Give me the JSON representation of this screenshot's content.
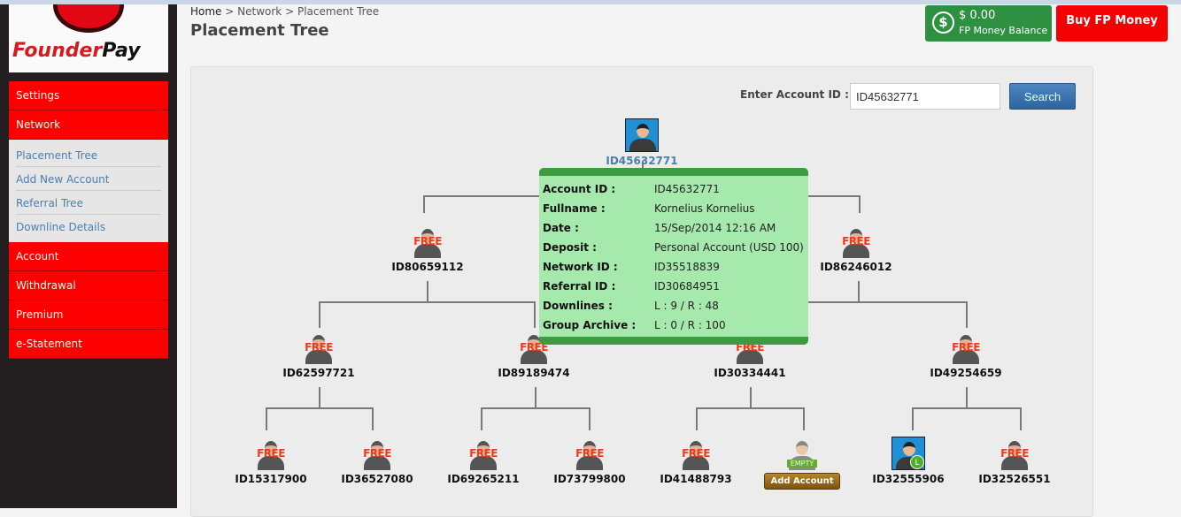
{
  "brand": {
    "name_a": "Founder",
    "name_b": "Pay"
  },
  "sidebar": {
    "items": [
      {
        "label": "Settings"
      },
      {
        "label": "Network"
      }
    ],
    "network_sub": [
      {
        "label": "Placement Tree"
      },
      {
        "label": "Add New Account"
      },
      {
        "label": "Referral Tree"
      },
      {
        "label": "Downline Details"
      }
    ],
    "items2": [
      {
        "label": "Account"
      },
      {
        "label": "Withdrawal"
      },
      {
        "label": "Premium"
      },
      {
        "label": "e-Statement"
      }
    ]
  },
  "breadcrumb": {
    "home": "Home",
    "sep": ">",
    "network": "Network",
    "current": "Placement Tree"
  },
  "page_title": "Placement Tree",
  "balance": {
    "icon": "dollar-icon",
    "amount": "$ 0.00",
    "label": "FP Money Balance"
  },
  "buy_label": "Buy FP Money",
  "search": {
    "label": "Enter Account ID :",
    "value": "ID45632771",
    "button": "Search"
  },
  "tree": {
    "root": {
      "id": "ID45632771",
      "status": "active"
    },
    "level1": [
      {
        "id": "ID80659112",
        "status": "free"
      },
      {
        "id": "ID86246012",
        "status": "free"
      }
    ],
    "level2": [
      {
        "id": "ID62597721",
        "status": "free"
      },
      {
        "id": "ID89189474",
        "status": "free"
      },
      {
        "id": "ID30334441",
        "status": "free"
      },
      {
        "id": "ID49254659",
        "status": "free"
      }
    ],
    "level3": [
      {
        "id": "ID15317900",
        "status": "free"
      },
      {
        "id": "ID36527080",
        "status": "free"
      },
      {
        "id": "ID69265211",
        "status": "free"
      },
      {
        "id": "ID73799800",
        "status": "free"
      },
      {
        "id": "ID41488793",
        "status": "free"
      },
      {
        "id": "",
        "status": "empty"
      },
      {
        "id": "ID32555906",
        "status": "active-left"
      },
      {
        "id": "ID32526551",
        "status": "free"
      }
    ],
    "free_label": "FREE",
    "empty_label": "EMPTY",
    "add_label": "Add Account",
    "left_badge": "L"
  },
  "popup": {
    "rows": [
      {
        "k": "Account ID :",
        "v": "ID45632771"
      },
      {
        "k": "Fullname :",
        "v": "Kornelius Kornelius"
      },
      {
        "k": "Date :",
        "v": "15/Sep/2014 12:16 AM"
      },
      {
        "k": "Deposit :",
        "v": "Personal Account (USD 100)"
      },
      {
        "k": "Network ID :",
        "v": "ID35518839"
      },
      {
        "k": "Referral ID :",
        "v": "ID30684951"
      },
      {
        "k": "Downlines :",
        "v": "L : 9 / R : 48"
      },
      {
        "k": "Group Archive :",
        "v": "L : 0 / R : 100"
      }
    ]
  }
}
